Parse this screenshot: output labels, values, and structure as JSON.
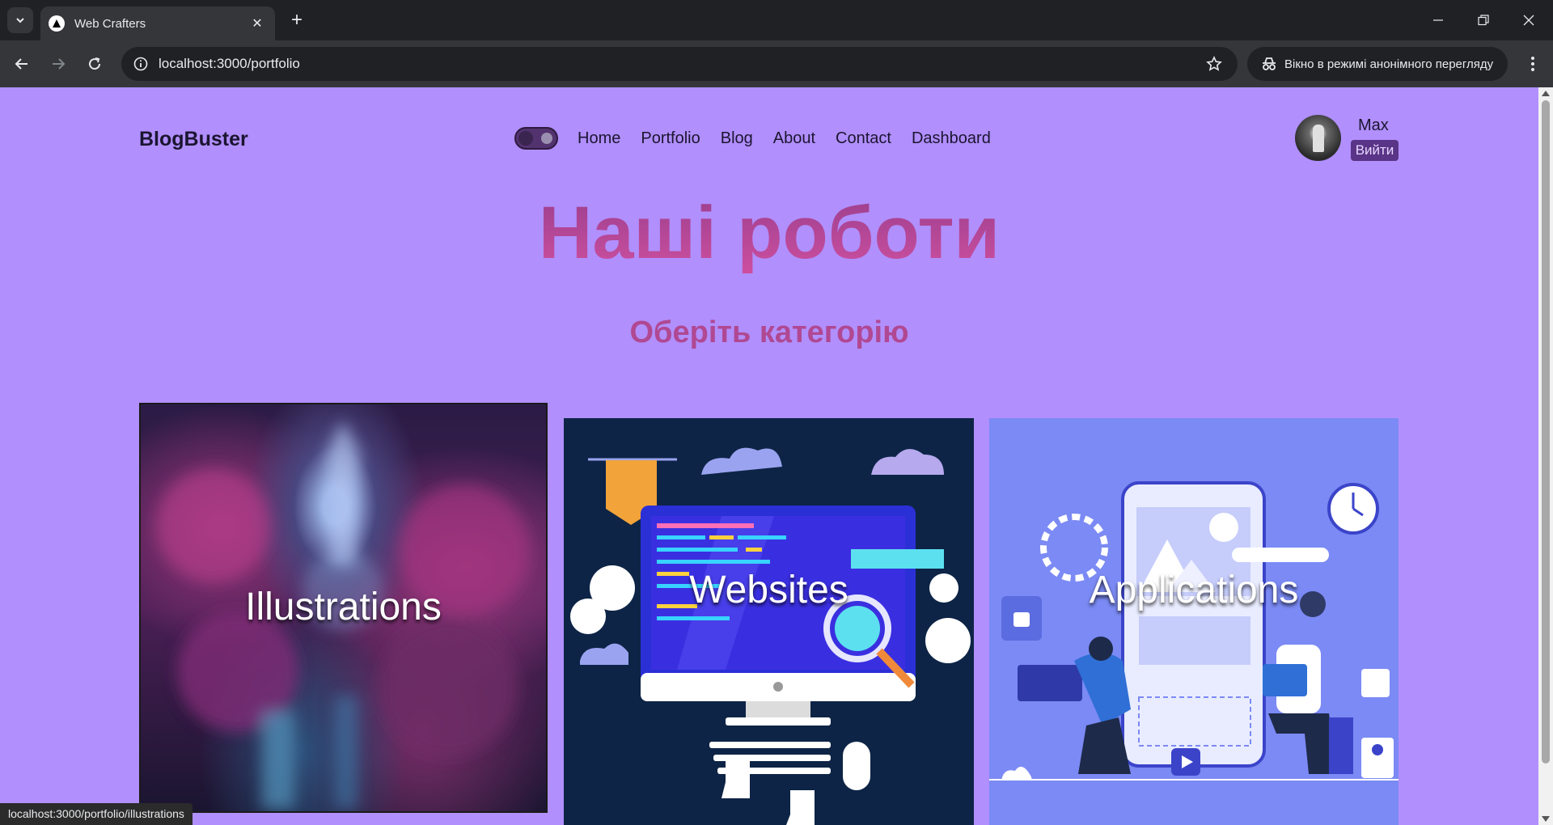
{
  "browser": {
    "tab_title": "Web Crafters",
    "url": "localhost:3000/portfolio",
    "incognito_label": "Вікно в режимі анонімного перегляду",
    "status_url": "localhost:3000/portfolio/illustrations"
  },
  "site": {
    "logo": "BlogBuster",
    "nav": [
      "Home",
      "Portfolio",
      "Blog",
      "About",
      "Contact",
      "Dashboard"
    ],
    "user": {
      "name": "Max",
      "logout": "Вийти"
    }
  },
  "main": {
    "title": "Наші роботи",
    "subtitle": "Оберіть категорію",
    "categories": [
      {
        "label": "Illustrations"
      },
      {
        "label": "Websites"
      },
      {
        "label": "Applications"
      }
    ]
  },
  "theme": {
    "page_bg": "#b18ffd",
    "heading": "#b04892",
    "logout_bg": "#5a3487"
  }
}
